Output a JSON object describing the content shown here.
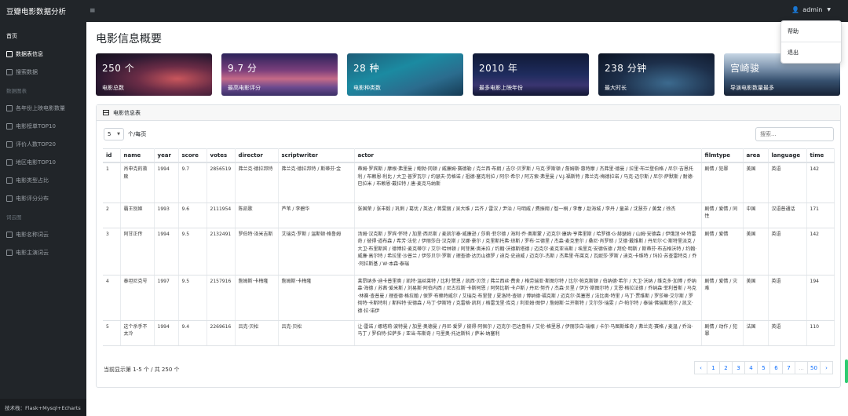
{
  "app": {
    "brand": "豆瓣电影数据分析",
    "footer": "技术栈：Flask+Mysql+Echarts"
  },
  "navbar": {
    "toggle_icon": "≡",
    "user": "admin",
    "dropdown": [
      "帮助",
      "退出"
    ]
  },
  "sidebar": {
    "items": [
      {
        "label": "首页",
        "active": true
      },
      {
        "label": "数据表信息",
        "active": true
      },
      {
        "label": "搜索数据",
        "active": false
      }
    ],
    "heading1": "数据图表",
    "charts": [
      "各年份上映电影数量",
      "电影榜单TOP10",
      "评价人数TOP20",
      "地区电影TOP10",
      "电影类型占比",
      "电影评分分布"
    ],
    "heading2": "词云图",
    "wordclouds": [
      "电影名称词云",
      "电影主演词云"
    ]
  },
  "page": {
    "title": "电影信息概要"
  },
  "cards": [
    {
      "value": "250 个",
      "label": "电影总数"
    },
    {
      "value": "9.7 分",
      "label": "最高电影评分"
    },
    {
      "value": "28 种",
      "label": "电影种类数"
    },
    {
      "value": "2010 年",
      "label": "最多电影上映年份"
    },
    {
      "value": "238 分钟",
      "label": "最大时长"
    },
    {
      "value": "宫崎骏",
      "label": "导演电影数量最多"
    }
  ],
  "table_panel": {
    "header": "电影信息表",
    "per_page_value": "5",
    "per_page_label": "个/每页",
    "search_placeholder": "搜索...",
    "columns": [
      "id",
      "name",
      "year",
      "score",
      "votes",
      "director",
      "scriptwriter",
      "actor",
      "filmtype",
      "area",
      "language",
      "time"
    ],
    "rows": [
      [
        "1",
        "肖申克的救赎",
        "1994",
        "9.7",
        "2856519",
        "弗兰克·德拉邦特",
        "弗兰克·德拉邦特 / 斯蒂芬·金",
        "蒂姆·罗宾斯 / 摩根·弗里曼 / 鲍勃·冈顿 / 威廉姆·赛德勒 / 克兰西·布朗 / 吉尔·贝罗斯 / 马克·罗斯顿 / 詹姆斯·惠特摩 / 杰弗里·德曼 / 拉里·布兰登伯格 / 尼尔·吉恩托利 / 布赖恩·利比 / 大卫·普罗瓦尔 / 约瑟夫·劳格诺 / 祖德·塞克利拉 / 阿尔·希尔 / 阿方索·弗里曼 / V.J.福斯特 / 弗兰克·梅德拉诺 / 马克·迈尔斯 / 尼尔·萨默斯 / 耐德·巴拉米 / 布赖恩·戴拉特 / 唐·麦克马纳斯",
        "剧情 / 犯罪",
        "美国",
        "英语",
        "142"
      ],
      [
        "2",
        "霸王别姬",
        "1993",
        "9.6",
        "2111954",
        "陈凯歌",
        "芦苇 / 李碧华",
        "张国荣 / 张丰毅 / 巩俐 / 葛优 / 英达 / 蒋雯丽 / 吴大维 / 吕齐 / 雷汉 / 尹治 / 马明威 / 费振翔 / 智一桐 / 李春 / 赵海城 / 李丹 / 童弟 / 沈慧芬 / 黄斐 / 徐杰",
        "剧情 / 爱情 / 同性",
        "中国",
        "汉语普通话",
        "171"
      ],
      [
        "3",
        "阿甘正传",
        "1994",
        "9.5",
        "2132491",
        "罗伯特·泽米吉斯",
        "艾瑞克·罗斯 / 温斯顿·格鲁姆",
        "汤姆·汉克斯 / 罗宾·怀特 / 加里·西尼斯 / 麦凯尔泰·威廉逊 / 莎莉·菲尔德 / 海利·乔·奥斯蒙 / 迈克尔·康纳·亨弗里斯 / 哈罗德·G·赫瑟姆 / 山姆·安德森 / 伊俄涅·M·特雷奇 / 彼得·道布森 / 希芳·法伦 / 伊丽莎白·汉克斯 / 汉娜·豪尔 / 克里斯托弗·琼斯 / 罗布·兰德里 / 杰森·麦克奎尔 / 桑尼·肖罗耶 / 艾德·戴维斯 / 丹尼尔·C·斯特里派克 / 大卫·布里斯宾 / 德博拉·麦克蒂尔 / 艾尔·哈林顿 / 阿菲莫·奥米拉 / 约翰·沃德斯塔德 / 迈克尔·麦克亚当斯 / 埃里克·安德伍德 / 拜伦·明斯 / 斯蒂芬·布吉格沃特 / 约翰·威廉·高尔特 / 希拉里·沙普兰 / 伊莎贝尔·罗斯 / 理查德·达历山德罗 / 迪克·史迪威 / 迈克尔-杰斯 / 杰弗里·布莱克 / 瓦妮莎·罗斯 / 迪克·卡维特 / 玛拉·苏查雷特克 / 乔·阿拉斯基 / W·本森·泰瑞",
        "剧情 / 爱情",
        "美国",
        "英语",
        "142"
      ],
      [
        "4",
        "泰坦尼克号",
        "1997",
        "9.5",
        "2157916",
        "詹姆斯·卡梅隆",
        "詹姆斯·卡梅隆",
        "莱昂纳多·迪卡普里奥 / 凯特·温丝莱特 / 比利·赞恩 / 凯西·贝茨 / 弗兰西丝·费舍 / 格劳瑞亚·斯图尔特 / 比尔·帕克斯顿 / 伯纳德·希尔 / 大卫·沃纳 / 维克多·加博 / 乔纳森·海德 / 苏茜·爱米斯 / 刘易斯·阿伯内西 / 尼古拉斯·卡斯柯恩 / 阿努比斯·卡卢斯 / 丹尼·努齐 / 杰森·贝里 / 伊万·斯图尔特 / 艾恩·格拉法德 / 乔纳森·菲利普斯 / 马克·林赛·查普曼 / 理查德·格拉翰 / 保罗·布赖特威尔 / 艾瑞克·布里登 / 夏洛特·查顿 / 博纳德·福克斯 / 迈克尔·英塞恩 / 法比奥·特里 / 马丁·贾维斯 / 罗莎琳·艾尔斯 / 罗彻特·卡斯特利 / 斯科特·安德森 / 马丁·伊斯特 / 克雷格·凯利 / 格雷戈里·库克 / 利亚姆·图伊 / 詹姆斯·兰开斯特 / 艾尔莎·瑞雯 / 卢·帕尔特 / 泰瑞·佛瑞斯塔尔 / 凯文·德·拉·诺伊",
        "剧情 / 爱情 / 灾难",
        "美国",
        "英语",
        "194"
      ],
      [
        "5",
        "这个杀手不太冷",
        "1994",
        "9.4",
        "2269616",
        "吕克·贝松",
        "吕克·贝松",
        "让·雷诺 / 娜塔莉·波特曼 / 加里·奥德曼 / 丹尼·爱罗 / 彼得·阿佩尔 / 迈克尔·巴达鲁科 / 艾伦·格里恩 / 伊丽莎白·瑞根 / 卡尔·马图斯维奇 / 弗兰克·赛格 / 麦温 / 乔治·马丁 / 罗伯特·拉萨多 / 亚当·布斯奇 / 马里奥·托达斯科 / 萨米·纳塞利",
        "剧情 / 动作 / 犯罪",
        "法国",
        "英语",
        "110"
      ]
    ],
    "info": "当前显示第 1-5 个 / 共 250 个",
    "pages": [
      "‹",
      "1",
      "2",
      "3",
      "4",
      "5",
      "6",
      "7",
      "...",
      "50",
      "›"
    ]
  }
}
